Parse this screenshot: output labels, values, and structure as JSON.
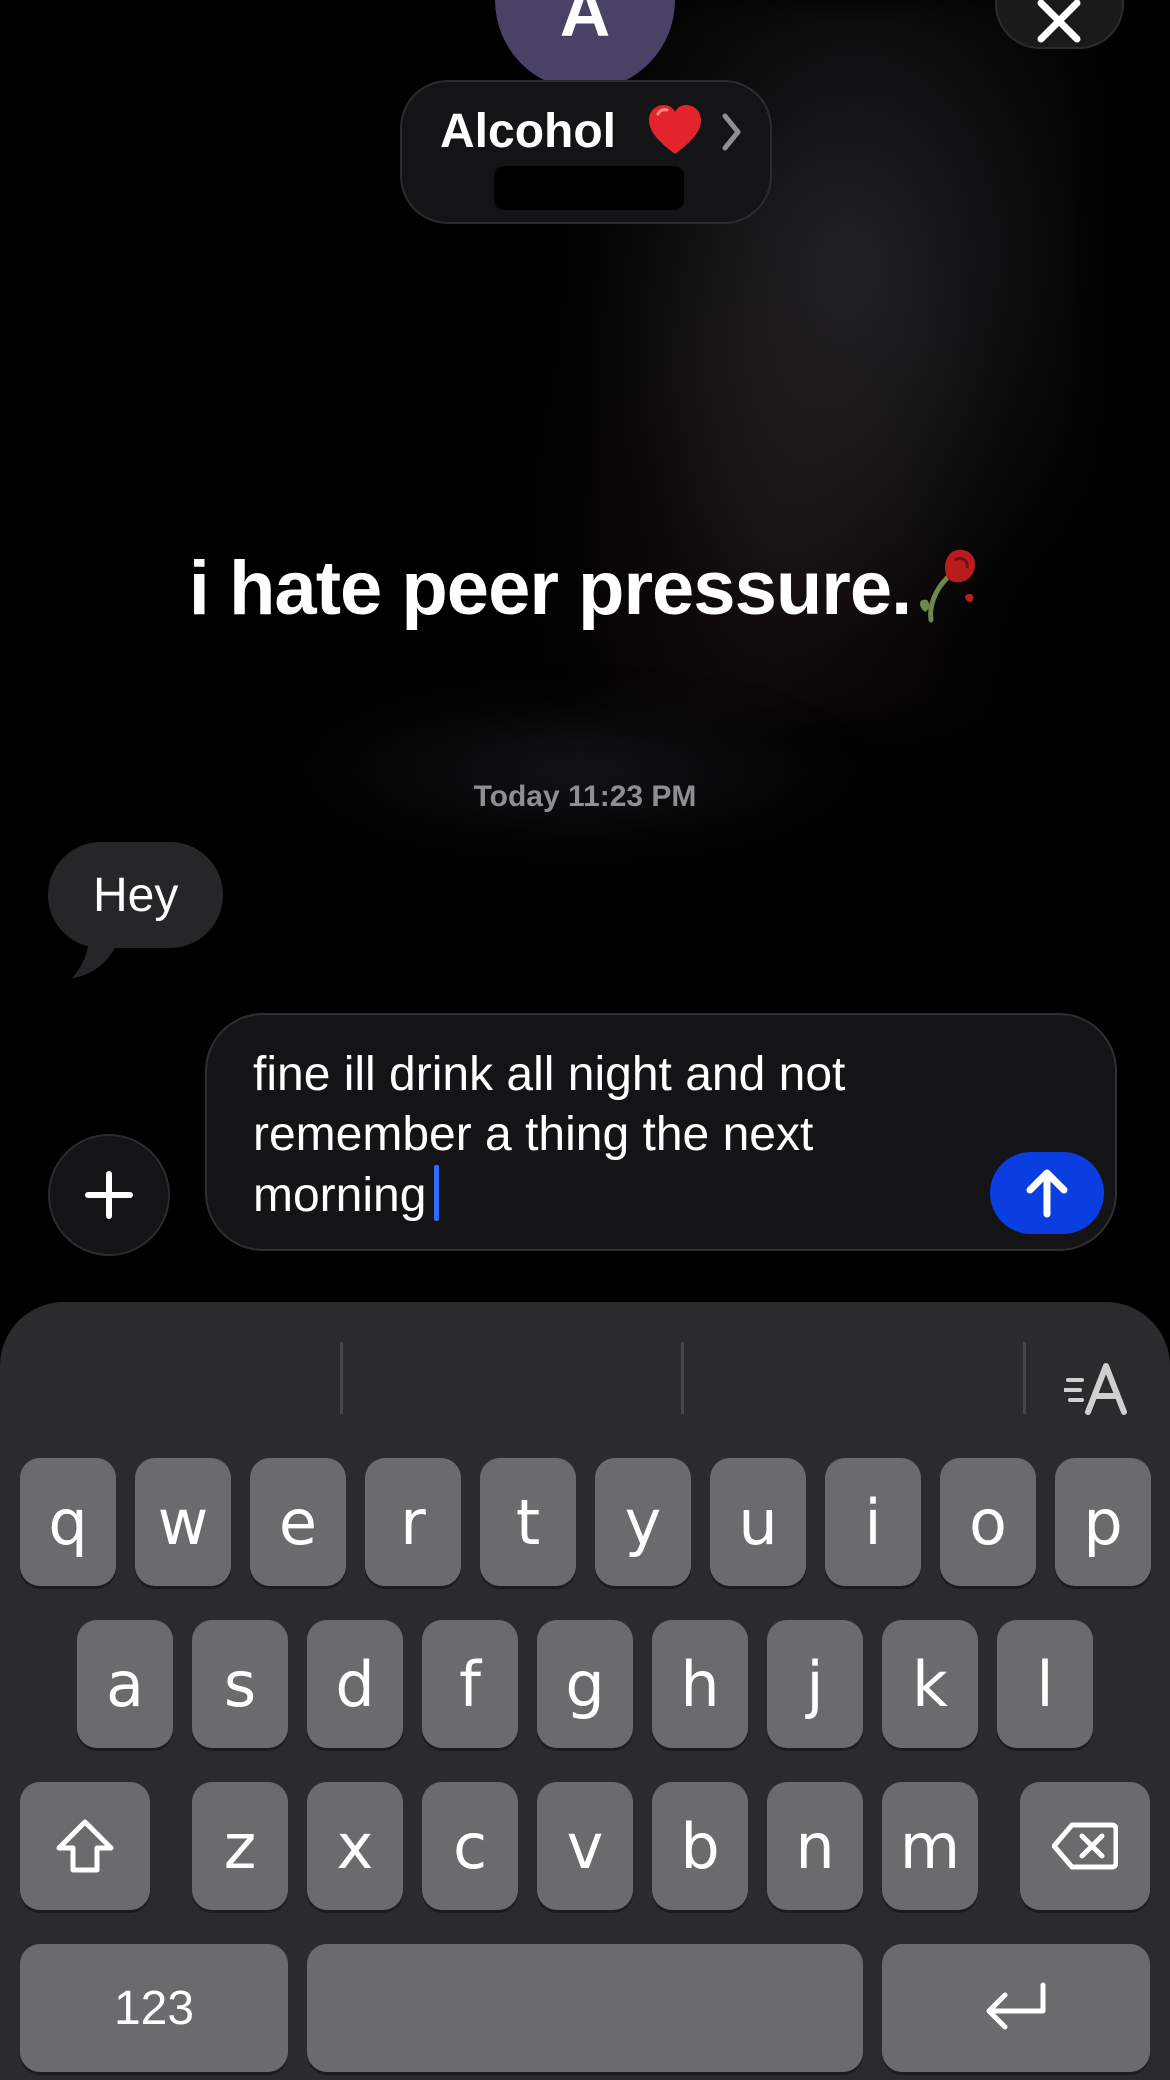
{
  "header": {
    "avatar_letter": "A",
    "contact_name": "Alcohol"
  },
  "conversation": {
    "status_note": "i hate peer pressure.",
    "timestamp": "Today 11:23 PM",
    "messages": [
      {
        "direction": "incoming",
        "text": "Hey"
      }
    ]
  },
  "composer": {
    "text": "fine ill drink all night and not remember a thing the next morning"
  },
  "keyboard": {
    "row1": [
      "q",
      "w",
      "e",
      "r",
      "t",
      "y",
      "u",
      "i",
      "o",
      "p"
    ],
    "row2": [
      "a",
      "s",
      "d",
      "f",
      "g",
      "h",
      "j",
      "k",
      "l"
    ],
    "row3": [
      "z",
      "x",
      "c",
      "v",
      "b",
      "n",
      "m"
    ],
    "numbers_label": "123"
  },
  "colors": {
    "background": "#000000",
    "send_button": "#0a3ee0",
    "caret": "#2f6bff",
    "incoming_bubble": "#262628",
    "keyboard_bg": "#2b2b2d",
    "key_bg": "#6b6b6d",
    "avatar_bg": "#4a4266"
  },
  "icons": [
    "heart-icon",
    "chevron-right-icon",
    "close-icon",
    "wilted-rose-icon",
    "plus-icon",
    "arrow-up-icon",
    "text-format-icon",
    "shift-icon",
    "delete-icon",
    "return-icon"
  ]
}
